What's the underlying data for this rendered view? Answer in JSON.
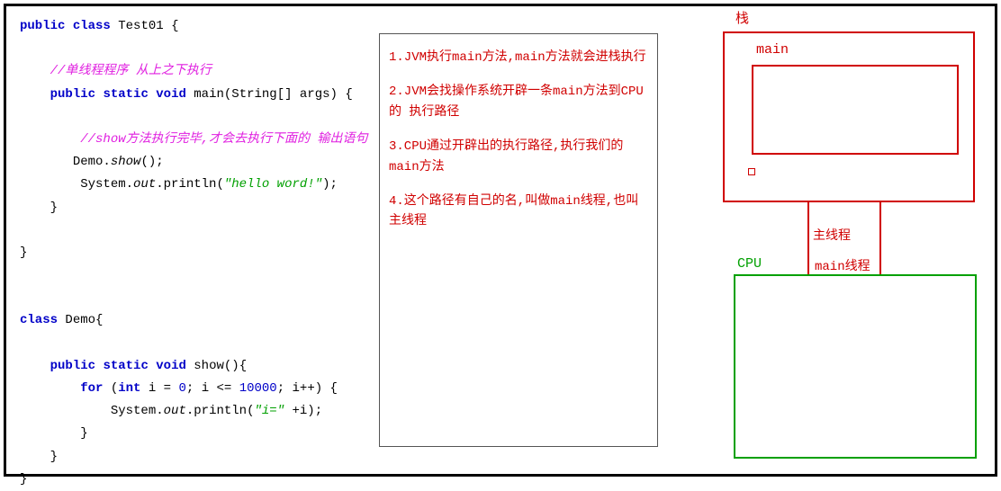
{
  "code": {
    "class1": {
      "kw_public": "public",
      "kw_class": "class",
      "name": "Test01",
      "brace_open": "{",
      "comment1": "//单线程程序 从上之下执行",
      "kw_static": "static",
      "kw_void": "void",
      "main_name": "main",
      "main_params": "(String[] args) {",
      "comment2": "//show方法执行完毕,才会去执行下面的 输出语句",
      "demo_call1": "Demo.",
      "demo_call2": "show",
      "demo_call3": "();",
      "println1": "System.",
      "println1_out": "out",
      "println1_method": ".println(",
      "println1_str": "\"hello word!\"",
      "println1_end": ");",
      "brace_close_method": "}",
      "brace_close_class": "}"
    },
    "class2": {
      "kw_public": "public",
      "kw_class": "class",
      "name": "Demo",
      "brace_open": "{",
      "kw_static": "static",
      "kw_void": "void",
      "show_name": "show",
      "show_params": "(){",
      "kw_for": "for",
      "for_open": " (",
      "kw_int": "int",
      "for_init": " i = ",
      "for_num0": "0",
      "for_cond": "; i <= ",
      "for_num1": "10000",
      "for_inc": "; i++) {",
      "println2": "System.",
      "println2_out": "out",
      "println2_method": ".println(",
      "println2_str": "\"i=\"",
      "println2_plus": " +i);",
      "brace_close_for": "}",
      "brace_close_method": "}",
      "brace_close_class": "}"
    }
  },
  "notes": {
    "n1": "1.JVM执行main方法,main方法就会进栈执行",
    "n2": "2.JVM会找操作系统开辟一条main方法到CPU的 执行路径",
    "n3": "3.CPU通过开辟出的执行路径,执行我们的main方法",
    "n4": "4.这个路径有自己的名,叫做main线程,也叫主线程"
  },
  "diagram": {
    "stack_label": "栈",
    "main_label": "main",
    "thread_label1": "主线程",
    "cpu_label": "CPU",
    "thread_label2": "main线程"
  }
}
